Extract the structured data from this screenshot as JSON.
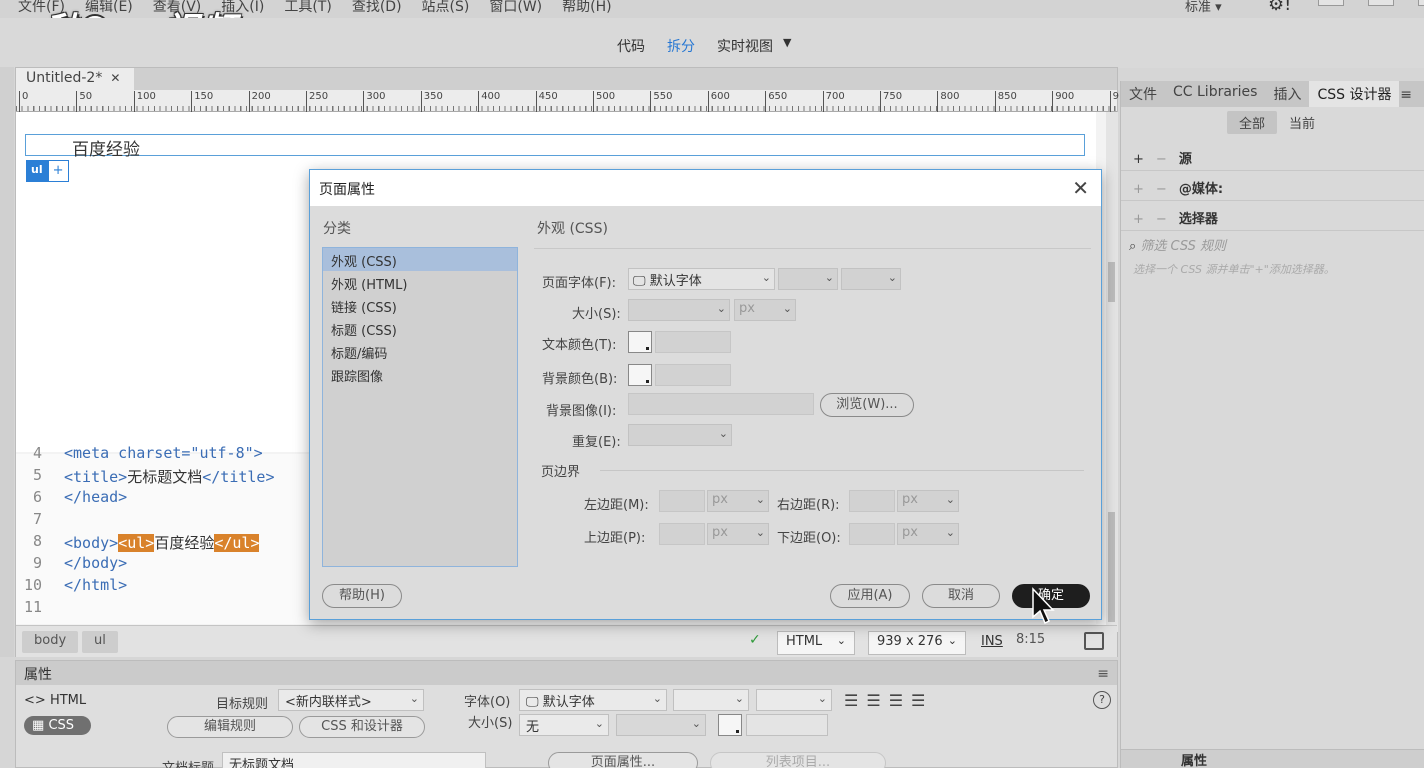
{
  "menubar": {
    "items": [
      "文件(F)",
      "编辑(E)",
      "查看(V)",
      "插入(I)",
      "工具(T)",
      "查找(D)",
      "站点(S)",
      "窗口(W)",
      "帮助(H)"
    ],
    "workspace": "标准"
  },
  "watermark": "秒dong视频",
  "viewbar": {
    "code": "代码",
    "split": "拆分",
    "live": "实时视图"
  },
  "document": {
    "tab_title": "Untitled-2*",
    "ruler_ticks": [
      "0",
      "50",
      "100",
      "150",
      "200",
      "250",
      "300",
      "350",
      "400",
      "450",
      "500",
      "550",
      "600",
      "650",
      "700",
      "750",
      "800",
      "850",
      "900",
      "9"
    ],
    "design_text": "百度经验",
    "element_badge": "ul",
    "element_badge_add": "+",
    "code_lines": [
      {
        "num": "4",
        "pre": "<meta charset=\"utf-8\">",
        "mid": "",
        "post": ""
      },
      {
        "num": "5",
        "pre": "<title>",
        "mid": "无标题文档",
        "post": "</title>"
      },
      {
        "num": "6",
        "pre": "</head>",
        "mid": "",
        "post": ""
      },
      {
        "num": "7",
        "pre": "",
        "mid": "",
        "post": ""
      },
      {
        "num": "8",
        "pre": "<body>",
        "hl1": "<ul>",
        "mid": "百度经验",
        "hl2": "</ul>",
        "post": ""
      },
      {
        "num": "9",
        "pre": "</body>",
        "mid": "",
        "post": ""
      },
      {
        "num": "10",
        "pre": "</html>",
        "mid": "",
        "post": ""
      },
      {
        "num": "11",
        "pre": "",
        "mid": "",
        "post": ""
      }
    ],
    "status": {
      "crumb_body": "body",
      "crumb_ul": "ul",
      "doc_type": "HTML",
      "size": "939 x 276",
      "ins": "INS",
      "position": "8:15"
    }
  },
  "properties": {
    "title": "属性",
    "html_label": "HTML",
    "css_label": "CSS",
    "target_rule_label": "目标规则",
    "target_rule_value": "<新内联样式>",
    "edit_rule": "编辑规则",
    "css_designer": "CSS 和设计器",
    "font_label": "字体(O)",
    "font_value": "默认字体",
    "size_label": "大小(S)",
    "size_value": "无",
    "doc_title_label": "文档标题",
    "doc_title_value": "无标题文档",
    "page_props": "页面属性...",
    "list_item": "列表项目..."
  },
  "right_panel": {
    "tabs": [
      "文件",
      "CC Libraries",
      "插入",
      "CSS 设计器"
    ],
    "seg_all": "全部",
    "seg_current": "当前",
    "row_source": "源",
    "row_media": "@媒体:",
    "row_selector": "选择器",
    "filter_placeholder": "筛选 CSS 规则",
    "hint": "选择一个 CSS 源并单击\"+\"添加选择器。",
    "bottom_label": "属性"
  },
  "dialog": {
    "title": "页面属性",
    "category_label": "分类",
    "categories": [
      "外观 (CSS)",
      "外观 (HTML)",
      "链接 (CSS)",
      "标题 (CSS)",
      "标题/编码",
      "跟踪图像"
    ],
    "selected_category": "外观 (CSS)",
    "section_title": "外观 (CSS)",
    "page_font_label": "页面字体(F):",
    "page_font_value": "默认字体",
    "size_label": "大小(S):",
    "size_unit": "px",
    "text_color_label": "文本颜色(T):",
    "bg_color_label": "背景颜色(B):",
    "bg_image_label": "背景图像(I):",
    "browse": "浏览(W)...",
    "repeat_label": "重复(E):",
    "margins_label": "页边界",
    "left_margin": "左边距(M):",
    "right_margin": "右边距(R):",
    "top_margin": "上边距(P):",
    "bottom_margin": "下边距(O):",
    "unit_px": "px",
    "help": "帮助(H)",
    "apply": "应用(A)",
    "cancel": "取消",
    "ok": "确定"
  },
  "colors": {
    "accent": "#2878d3",
    "highlight": "#d9822b",
    "dialog_border": "#5aa0d9",
    "selection": "#a9bfdc"
  }
}
